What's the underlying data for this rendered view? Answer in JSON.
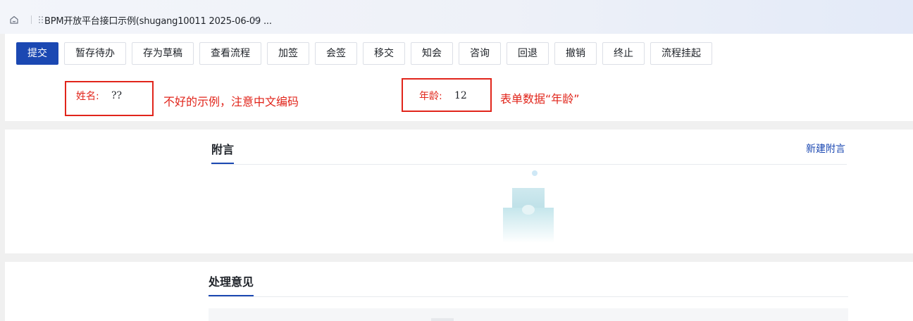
{
  "tab": {
    "title": "BPM开放平台接口示例(shugang10011 2025-06-09 ..."
  },
  "toolbar": {
    "buttons": [
      "提交",
      "暂存待办",
      "存为草稿",
      "查看流程",
      "加签",
      "会签",
      "移交",
      "知会",
      "咨询",
      "回退",
      "撤销",
      "终止",
      "流程挂起"
    ]
  },
  "form": {
    "name": {
      "label": "姓名:",
      "value": "??"
    },
    "name_note": "不好的示例，注意中文编码",
    "age": {
      "label": "年龄:",
      "value": "12"
    },
    "age_note": "表单数据“年龄”"
  },
  "attachments": {
    "title": "附言",
    "new_link": "新建附言"
  },
  "opinions": {
    "title": "处理意见"
  },
  "colors": {
    "primary": "#1b48b2",
    "annotation": "#e1251b"
  },
  "icons": [
    "home-icon",
    "drag-handle-icon",
    "close-icon",
    "empty-box-illustration"
  ]
}
